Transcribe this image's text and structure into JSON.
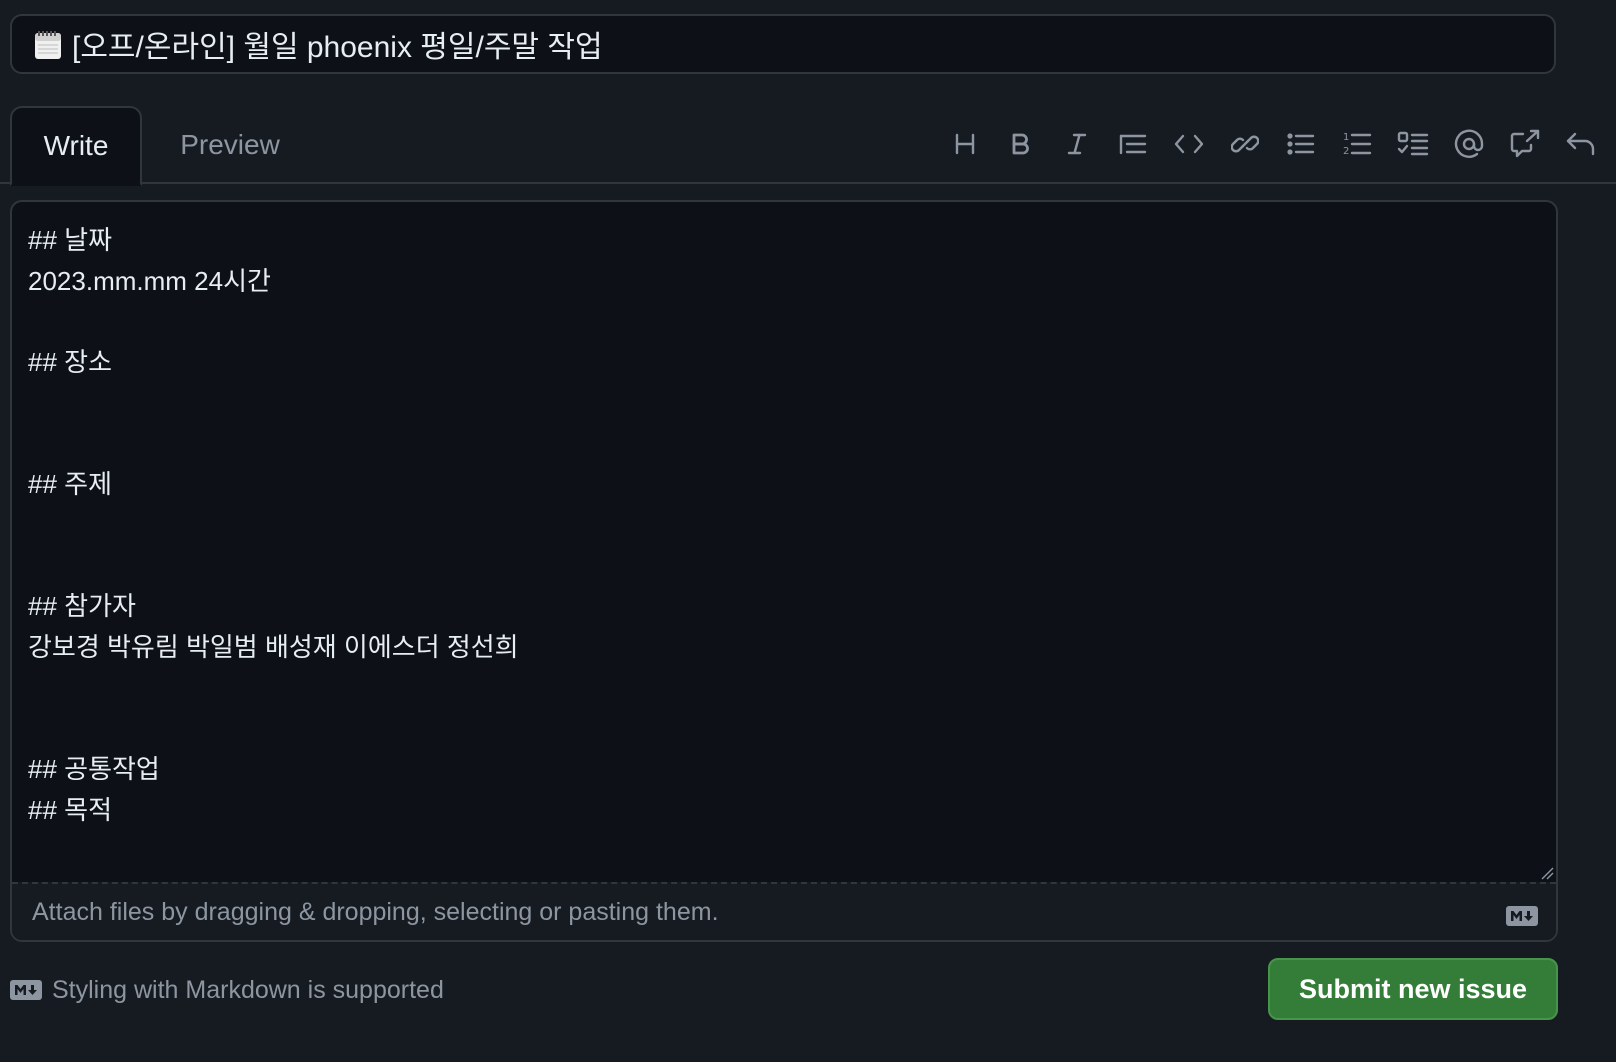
{
  "issue": {
    "title": "[오프/온라인] 월일 phoenix 평일/주말 작업"
  },
  "tabs": {
    "write": "Write",
    "preview": "Preview"
  },
  "toolbar": {
    "icons": [
      "heading-icon",
      "bold-icon",
      "italic-icon",
      "quote-icon",
      "code-icon",
      "link-icon",
      "bulleted-list-icon",
      "numbered-list-icon",
      "task-list-icon",
      "mention-icon",
      "cross-reference-icon",
      "undo-icon"
    ]
  },
  "editor": {
    "body": "## 날짜\n2023.mm.mm 24시간\n\n## 장소\n\n\n## 주제\n\n\n## 참가자\n강보경 박유림 박일범 배성재 이에스더 정선희\n\n\n## 공통작업\n## 목적"
  },
  "attach": {
    "label": "Attach files by dragging & dropping, selecting or pasting them."
  },
  "footer": {
    "markdown_note": "Styling with Markdown is supported",
    "submit_label": "Submit new issue"
  },
  "colors": {
    "background": "#161b22",
    "editor_bg": "#0d1117",
    "border": "#30363d",
    "muted_text": "#8d96a0",
    "submit_green": "#347d39"
  }
}
